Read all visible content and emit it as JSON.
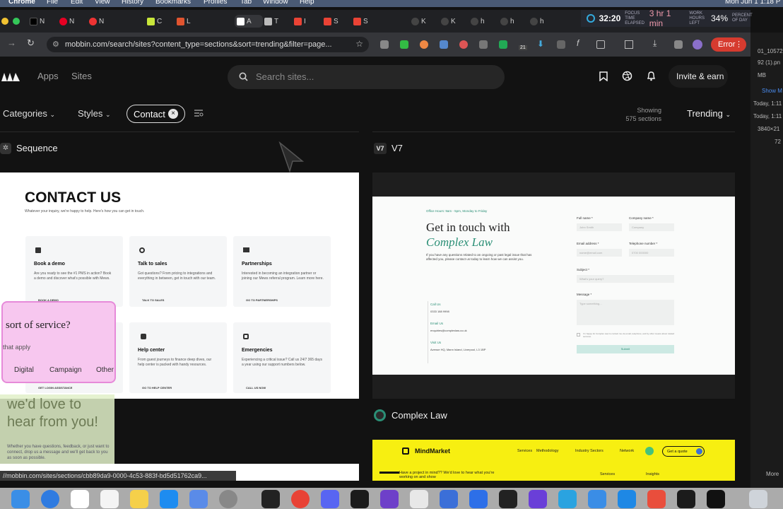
{
  "menubar": {
    "app": "Chrome",
    "items": [
      "File",
      "Edit",
      "View",
      "History",
      "Bookmarks",
      "Profiles",
      "Tab",
      "Window",
      "Help"
    ],
    "clock": "Mon Jun 1  1:18 P"
  },
  "timer": {
    "elapsed": "32:20",
    "elapsed_label": "FOCUS TIME ELAPSED",
    "remaining": "3 hr 1 min",
    "remaining_label": "WORK HOURS LEFT",
    "percent": "34%",
    "percent_label": "PERCENT OF DAY"
  },
  "tabs": [
    "N",
    "N",
    "N",
    "C",
    "L",
    "A",
    "T",
    "I",
    "S",
    "S",
    "K",
    "K",
    "h",
    "h",
    "h"
  ],
  "address": {
    "url": "mobbin.com/search/sites?content_type=sections&sort=trending&filter=page...",
    "error_label": "Error",
    "ext_badge": "21"
  },
  "nav": {
    "apps": "Apps",
    "sites": "Sites",
    "search_placeholder": "Search sites...",
    "invite": "Invite & earn"
  },
  "filters": {
    "categories": "Categories",
    "styles": "Styles",
    "contact": "Contact",
    "showing": "Showing",
    "count": "575 sections",
    "sort": "Trending"
  },
  "left_site": {
    "name": "Sequence",
    "card": {
      "title": "CONTACT US",
      "subtitle": "Whatever your inquiry, we're happy to help. Here's how you can get in touch.",
      "boxes": [
        {
          "title": "Book a demo",
          "desc": "Are you ready to see the #1 PMS in action? Book a demo and discover what's possible with Mews.",
          "link": "BOOK A DEMO"
        },
        {
          "title": "Talk to sales",
          "desc": "Got questions? From pricing to integrations and everything in between, get in touch with our team.",
          "link": "TALK TO SALES"
        },
        {
          "title": "Partnerships",
          "desc": "Interested in becoming an integration partner or joining our Mews referral program. Learn more here.",
          "link": "GO TO PARTNERSHIPS"
        },
        {
          "title": "",
          "desc": "",
          "link": "GET LOGIN ASSISTANCE"
        },
        {
          "title": "Help center",
          "desc": "From guest journeys to finance deep dives, our help center is packed with handy resources.",
          "link": "GO TO HELP CENTER"
        },
        {
          "title": "Emergencies",
          "desc": "Experiencing a critical issue? Call us 24/7 365 days a year using our support numbers below.",
          "link": "CALL US NOW"
        }
      ]
    }
  },
  "overlay": {
    "question": "sort of service?",
    "hint": "that apply",
    "options": [
      "Digital",
      "Campaign",
      "Other"
    ],
    "hello": "we'd love to hear from you!",
    "hello_body": "Whether you have questions, feedback, or just want to connect, drop us a message and we'll get back to you as soon as possible."
  },
  "right_site": {
    "name": "V7",
    "badge": "V7",
    "card": {
      "hours": "Office Hours: 9am - 5pm, Monday to Friday",
      "heading": "Get in touch with",
      "heading_accent": "Complex Law",
      "intro": "If you have any questions related to an ongoing or past legal issue that has affected you, please contact us today to learn how we can assist you.",
      "call_label": "Call Us",
      "call": "0333 188 9998",
      "email_label": "Email Us",
      "email": "enquiries@complexlaw.co.uk",
      "visit_label": "Visit Us",
      "visit": "Avenue HQ, Mann Island, Liverpool, L3 1BP",
      "fields": {
        "full_name": "Full name *",
        "full_name_ph": "John Smith",
        "company": "Company name *",
        "company_ph": "Company",
        "email": "Email address *",
        "email_ph": "name@email.com",
        "phone": "Telephone number *",
        "phone_ph": "0700 000000",
        "subject": "Subject *",
        "subject_ph": "What's your query?",
        "message": "Message *",
        "message_ph": "Type something..."
      },
      "consent": "I'm happy for Complex Law to contact me via email, telephone, and by other means about related services.",
      "submit": "Submit"
    }
  },
  "third_site": {
    "name": "Complex Law",
    "card": {
      "brand": "MindMarket",
      "nav": [
        "Services",
        "Methodology",
        "Industry Sectors",
        "Network"
      ],
      "cta": "Get a quote",
      "text": "Have a project in mind?? We'd love to hear what you're working on and show",
      "col1": "Services",
      "col2": "Insights"
    }
  },
  "status_url": "//mobbin.com/sites/sections/cbb89da9-0000-4c53-883f-bd5d51762ca9...",
  "right_panel": [
    "01_10572",
    "92 (1).pn",
    "MB",
    "Show M",
    "Today, 1:11",
    "Today, 1:11",
    "3840×21",
    "72",
    "More"
  ],
  "colors": {
    "accent_teal": "#2b8f76",
    "mindmarket_yellow": "#f7ef11",
    "error_red": "#d63b2f"
  }
}
